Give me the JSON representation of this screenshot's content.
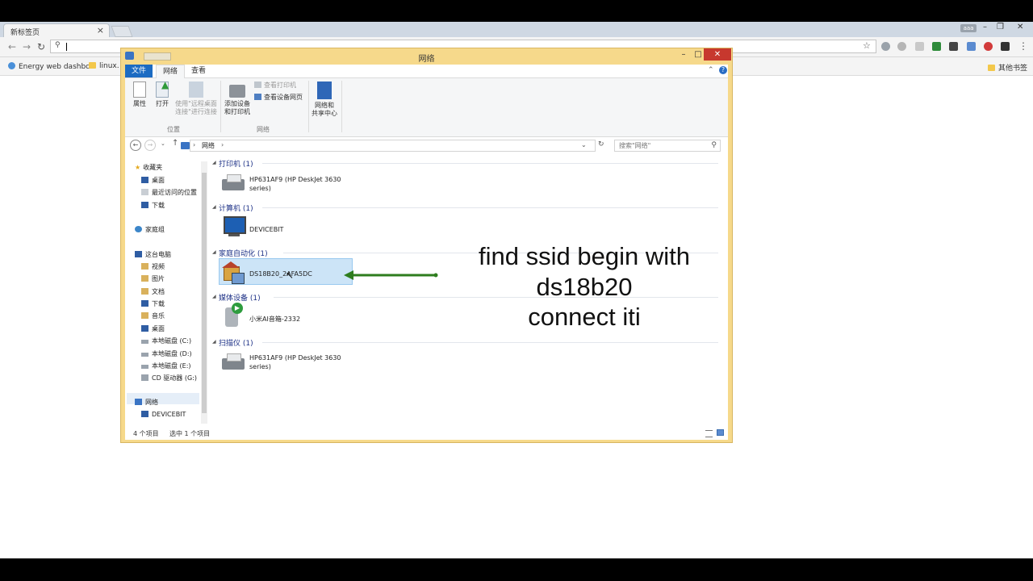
{
  "browser": {
    "tab_title": "新标签页",
    "tab_close": "×",
    "profile_label": "aaa",
    "window_min": "–",
    "window_restore": "❐",
    "window_close": "✕",
    "search_glyph": "🔍",
    "bookmarks": {
      "item1": "Energy web dashbc",
      "item2": "linux.",
      "other": "其他书签"
    }
  },
  "explorer": {
    "title": "网络",
    "ribbon_tabs": {
      "file": "文件",
      "network": "网络",
      "view": "查看"
    },
    "ribbon": {
      "properties": "属性",
      "open": "打开",
      "remote_line1": "使用\"远程桌面",
      "remote_line2": "连接\"进行连接",
      "group_location": "位置",
      "add_line1": "添加设备",
      "add_line2": "和打印机",
      "view_printers": "查看打印机",
      "view_device_page": "查看设备网页",
      "group_network": "网络",
      "share_line1": "网络和",
      "share_line2": "共享中心"
    },
    "address": {
      "path": "网络",
      "search_placeholder": "搜索\"网络\""
    },
    "nav": {
      "favorites": "收藏夹",
      "desktop": "桌面",
      "recent": "最近访问的位置",
      "downloads": "下载",
      "homegroup": "家庭组",
      "this_pc": "这台电脑",
      "videos": "视频",
      "pictures": "图片",
      "documents": "文档",
      "downloads2": "下载",
      "music": "音乐",
      "desktop2": "桌面",
      "disk_c": "本地磁盘 (C:)",
      "disk_d": "本地磁盘 (D:)",
      "disk_e": "本地磁盘 (E:)",
      "cd": "CD 驱动器 (G:)",
      "network": "网络",
      "devicebit": "DEVICEBIT"
    },
    "groups": {
      "printers": "打印机 (1)",
      "computers": "计算机 (1)",
      "home_automation": "家庭自动化 (1)",
      "media": "媒体设备 (1)",
      "scanners": "扫描仪 (1)"
    },
    "items": {
      "printer_line1": "HP631AF9 (HP DeskJet 3630",
      "printer_line2": "series)",
      "computer": "DEVICEBIT",
      "ds18b20": "DS18B20_2AFA5DC",
      "media": "小米AI音箱-2332",
      "scanner_line1": "HP631AF9 (HP DeskJet 3630",
      "scanner_line2": "series)"
    },
    "status": {
      "count": "4 个项目",
      "selected": "选中 1 个项目"
    }
  },
  "annotation": {
    "line1": "find  ssid begin with",
    "line2": "ds18b20",
    "line3": "connect iti",
    "arrow_color": "#2e7d1e"
  }
}
